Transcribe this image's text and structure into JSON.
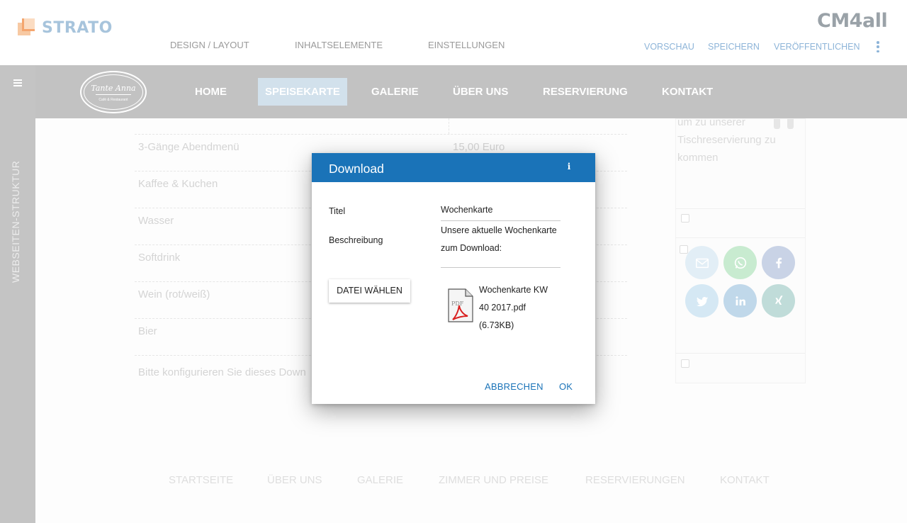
{
  "brand": {
    "strato": "STRATO",
    "cm4all": "CM4all"
  },
  "editor_tabs": [
    "DESIGN / LAYOUT",
    "INHALTSELEMENTE",
    "EINSTELLUNGEN"
  ],
  "editor_actions": {
    "preview": "VORSCHAU",
    "save": "SPEICHERN",
    "publish": "VERÖFFENTLICHEN"
  },
  "sidebar": {
    "label": "WEBSEITEN-STRUKTUR"
  },
  "site": {
    "logo_name": "Tante Anna",
    "logo_sub": "Café & Restaurant",
    "nav": [
      "HOME",
      "SPEISEKARTE",
      "GALERIE",
      "ÜBER UNS",
      "RESERVIERUNG",
      "KONTAKT"
    ],
    "active_nav": "SPEISEKARTE"
  },
  "menu_rows": [
    {
      "name": "3-Gänge Abendmenü",
      "price": "15,00 Euro"
    },
    {
      "name": "Kaffee & Kuchen",
      "price": ""
    },
    {
      "name": "Wasser",
      "price": ""
    },
    {
      "name": "Softdrink",
      "price": ""
    },
    {
      "name": "Wein (rot/weiß)",
      "price": ""
    },
    {
      "name": "Bier",
      "price": ""
    }
  ],
  "config_note": "Bitte konfigurieren Sie dieses Down",
  "right_panel_text": "um zu unserer Tischreservierung zu kommen",
  "social_icons": [
    "email-icon",
    "whatsapp-icon",
    "facebook-icon",
    "twitter-icon",
    "linkedin-icon",
    "xing-icon"
  ],
  "footer_nav": [
    "STARTSEITE",
    "ÜBER UNS",
    "GALERIE",
    "ZIMMER UND PREISE",
    "RESERVIERUNGEN",
    "KONTAKT"
  ],
  "dialog": {
    "title": "Download",
    "title_label": "Titel",
    "title_value": "Wochenkarte",
    "description_label": "Beschreibung",
    "description_value": "Unsere aktuelle Wochenkarte zum Download:",
    "choose_file": "DATEI WÄHLEN",
    "file_name": "Wochenkarte KW 40 2017.pdf",
    "file_size": "(6.73KB)",
    "cancel": "ABBRECHEN",
    "ok": "OK"
  },
  "colors": {
    "accent": "#1a73b8",
    "nav_bg": "#c2c2c2",
    "active_tab": "#d2e1ec"
  }
}
